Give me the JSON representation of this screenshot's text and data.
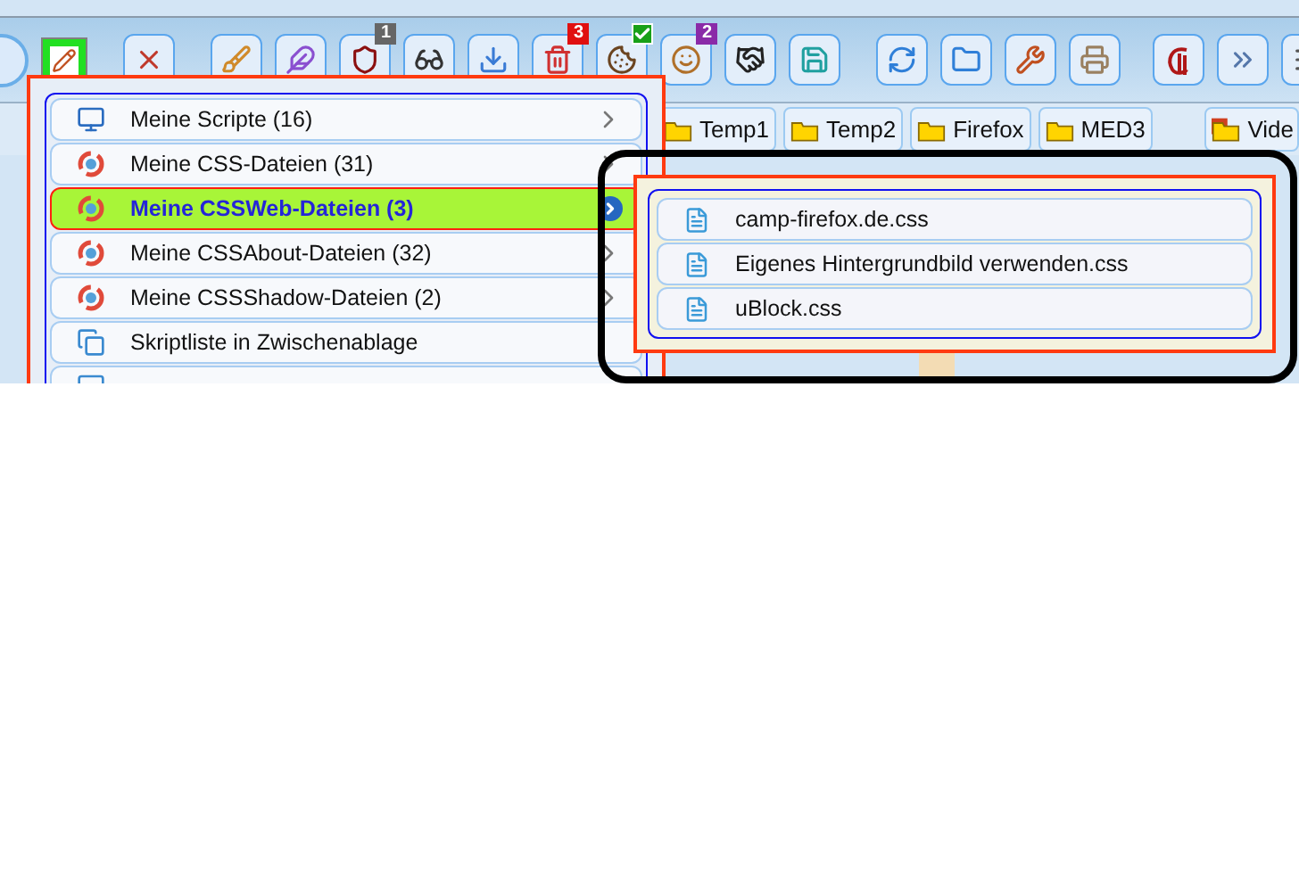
{
  "toolbar": {
    "groups": [
      [
        {
          "kind": "round"
        },
        {
          "kind": "highlight"
        }
      ],
      [
        {
          "kind": "plain"
        }
      ],
      [
        {
          "kind": "plain"
        },
        {
          "kind": "plain"
        },
        {
          "kind": "badge",
          "badge": "1"
        },
        {
          "kind": "plain"
        },
        {
          "kind": "plain"
        },
        {
          "kind": "badge",
          "badge": "3"
        },
        {
          "kind": "check"
        },
        {
          "kind": "badge",
          "badge": "2"
        },
        {
          "kind": "plain"
        },
        {
          "kind": "plain"
        }
      ],
      [
        {
          "kind": "plain"
        },
        {
          "kind": "plain"
        },
        {
          "kind": "plain"
        },
        {
          "kind": "plain"
        }
      ],
      [
        {
          "kind": "plain"
        },
        {
          "kind": "plain"
        },
        {
          "kind": "plain"
        }
      ]
    ]
  },
  "bookmarks": [
    {
      "label": "Temp1"
    },
    {
      "label": "Temp2"
    },
    {
      "label": "Firefox"
    },
    {
      "label": "MED3"
    },
    {
      "label": "Vide",
      "kind": "video"
    }
  ],
  "menu": {
    "items": [
      {
        "label": "Meine Scripte (16)",
        "kind": "scripts",
        "selected": false,
        "submenu": true
      },
      {
        "label": "Meine CSS-Dateien (31)",
        "kind": "css",
        "selected": false,
        "submenu": true
      },
      {
        "label": "Meine CSSWeb-Dateien (3)",
        "kind": "css",
        "selected": true,
        "submenu": true
      },
      {
        "label": "Meine CSSAbout-Dateien (32)",
        "kind": "css",
        "selected": false,
        "submenu": true
      },
      {
        "label": "Meine CSSShadow-Dateien (2)",
        "kind": "css",
        "selected": false,
        "submenu": true
      },
      {
        "label": "Skriptliste in Zwischenablage",
        "kind": "clipboard",
        "selected": false,
        "submenu": false
      }
    ]
  },
  "submenu": {
    "items": [
      {
        "label": "camp-firefox.de.css"
      },
      {
        "label": "Eigenes Hintergrundbild verwenden.css"
      },
      {
        "label": "uBlock.css"
      }
    ]
  }
}
